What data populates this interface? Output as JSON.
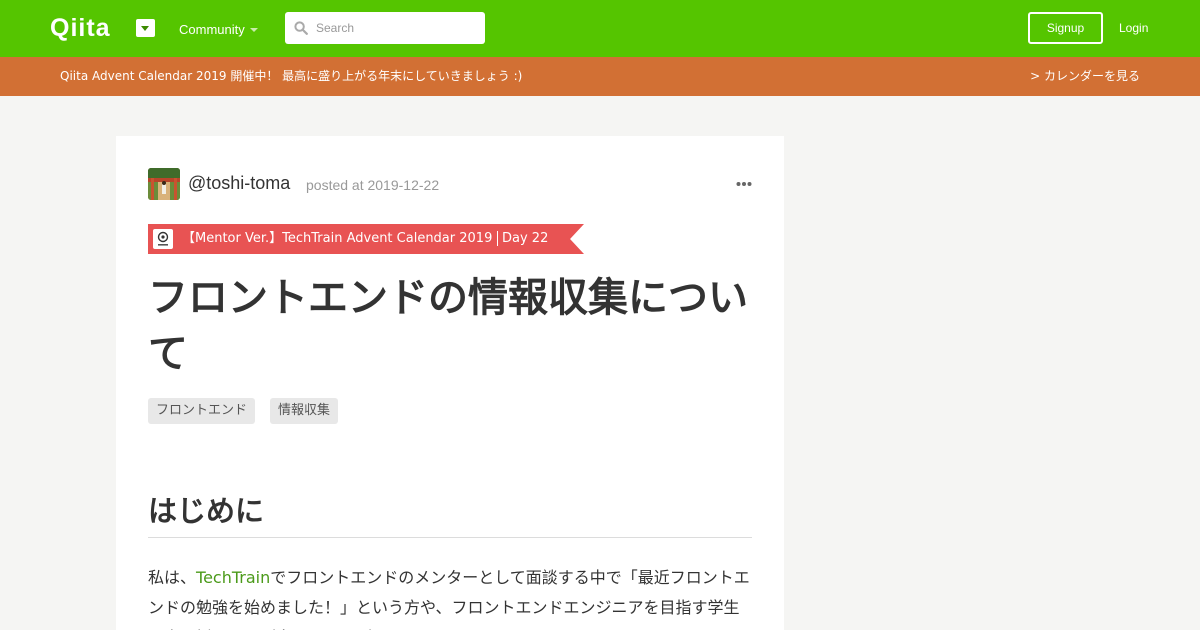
{
  "header": {
    "logo": "Qiita",
    "community_label": "Community",
    "search_placeholder": "Search",
    "signup_label": "Signup",
    "login_label": "Login",
    "brand_color": "#55c500"
  },
  "banner": {
    "text": "Qiita Advent Calendar 2019 開催中！ 最高に盛り上がる年末にしていきましょう :)",
    "link": "> カレンダーを見る",
    "color": "#d27034"
  },
  "article": {
    "author": "@toshi-toma",
    "posted": "posted at 2019-12-22",
    "calendar": {
      "title": "【Mentor Ver.】TechTrain Advent Calendar 2019",
      "day": "Day 22",
      "color": "#e85353"
    },
    "title": "フロントエンドの情報収集について",
    "tags": [
      "フロントエンド",
      "情報収集"
    ],
    "section_heading": "はじめに",
    "paragraph": {
      "prefix": "私は、",
      "link": "TechTrain",
      "suffix": "でフロントエンドのメンターとして面談する中で「最近フロントエンドの勉強を始めました！」という方や、フロントエンドエンジニアを目指す学生の方と話すことが多いのですが、"
    },
    "link_color": "#4b9a1a"
  }
}
